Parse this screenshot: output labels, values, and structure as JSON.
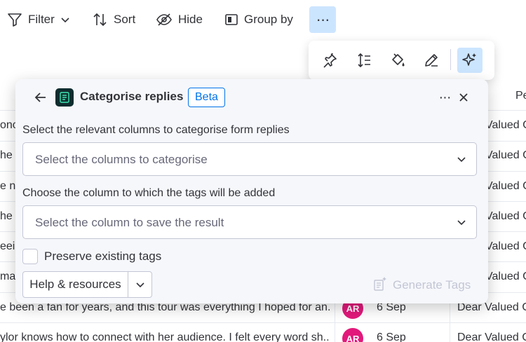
{
  "toolbar": {
    "filter_label": "Filter",
    "sort_label": "Sort",
    "hide_label": "Hide",
    "group_by_label": "Group by",
    "more_glyph": "···"
  },
  "icon_bar": {
    "icons": [
      "pin-icon",
      "row-height-icon",
      "paint-bucket-icon",
      "edit-pen-icon",
      "ai-sparkle-icon"
    ]
  },
  "table": {
    "header_right": "Pe",
    "rows": [
      {
        "text": "onc",
        "date": "",
        "initials": "",
        "right": "Valued C"
      },
      {
        "text": "he v",
        "date": "",
        "initials": "",
        "right": "Valued C"
      },
      {
        "text": "e no",
        "date": "",
        "initials": "",
        "right": "Valued C"
      },
      {
        "text": "he s",
        "date": "",
        "initials": "",
        "right": "Valued C"
      },
      {
        "text": "eein",
        "date": "",
        "initials": "",
        "right": "Valued C"
      },
      {
        "text": "maz",
        "date": "",
        "initials": "",
        "right": "Valued C"
      },
      {
        "text": "e been a fan for years, and this tour was everything I hoped for an...",
        "date": "6 Sep",
        "initials": "AR",
        "right": "Dear Valued C"
      },
      {
        "text": "ylor knows how to connect with her audience. I felt every word sh...",
        "date": "6 Sep",
        "initials": "AR",
        "right": "Dear Valued C"
      }
    ]
  },
  "dialog": {
    "title": "Categorise replies",
    "badge": "Beta",
    "columns_label": "Select the relevant columns to categorise form replies",
    "columns_placeholder": "Select the columns to categorise",
    "target_label": "Choose the column to which the tags will be added",
    "target_placeholder": "Select the column to save the result",
    "preserve_label": "Preserve existing tags",
    "preserve_checked": false,
    "help_label": "Help & resources",
    "generate_label": "Generate Tags",
    "more_glyph": "···"
  },
  "colors": {
    "accent": "#0073ea",
    "accent_bg": "#cce5ff",
    "avatar": "#e2197b",
    "dialog_bg": "#f6f7fb",
    "disabled_text": "#c3c6d4"
  }
}
